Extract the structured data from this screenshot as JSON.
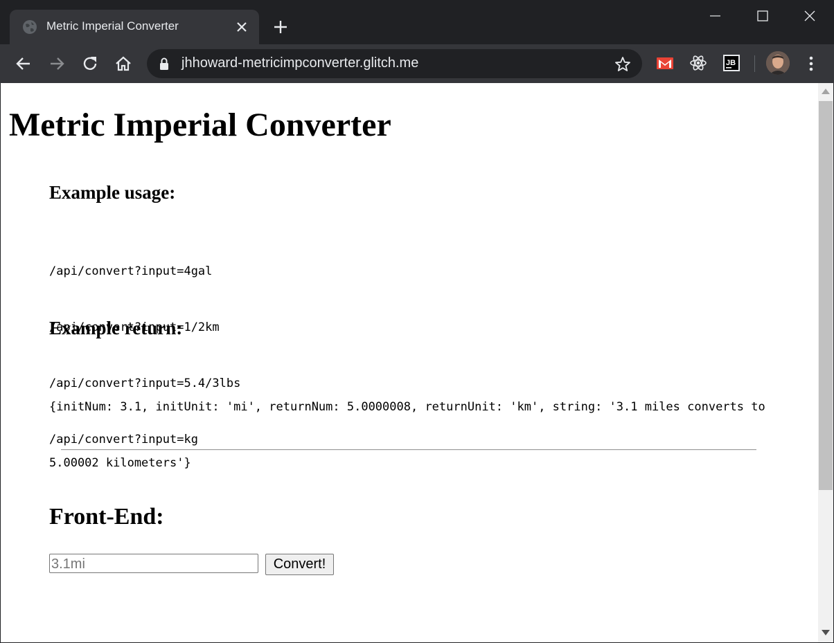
{
  "browser": {
    "tab_title": "Metric Imperial Converter",
    "url": "jhhoward-metricimpconverter.glitch.me",
    "icons": [
      "globe-icon",
      "close-icon",
      "plus-icon",
      "minimize-icon",
      "maximize-icon",
      "close-window-icon",
      "back-icon",
      "forward-icon",
      "reload-icon",
      "home-icon",
      "lock-icon",
      "star-icon",
      "gmail-icon",
      "react-icon",
      "jetbrains-icon",
      "avatar",
      "kebab-menu-icon"
    ],
    "extensions": {
      "jetbrains_label": "JB"
    }
  },
  "page": {
    "title": "Metric Imperial Converter",
    "usage_heading": "Example usage:",
    "usage_lines": [
      "/api/convert?input=4gal",
      "/api/convert?input=1/2km",
      "/api/convert?input=5.4/3lbs",
      "/api/convert?input=kg"
    ],
    "return_heading": "Example return:",
    "return_line1": "{initNum: 3.1, initUnit: 'mi', returnNum: 5.0000008, returnUnit: 'km', string: '3.1 miles converts to",
    "return_line2": "5.00002 kilometers'}",
    "frontend_heading": "Front-End:",
    "input_placeholder": "3.1mi",
    "convert_label": "Convert!"
  }
}
